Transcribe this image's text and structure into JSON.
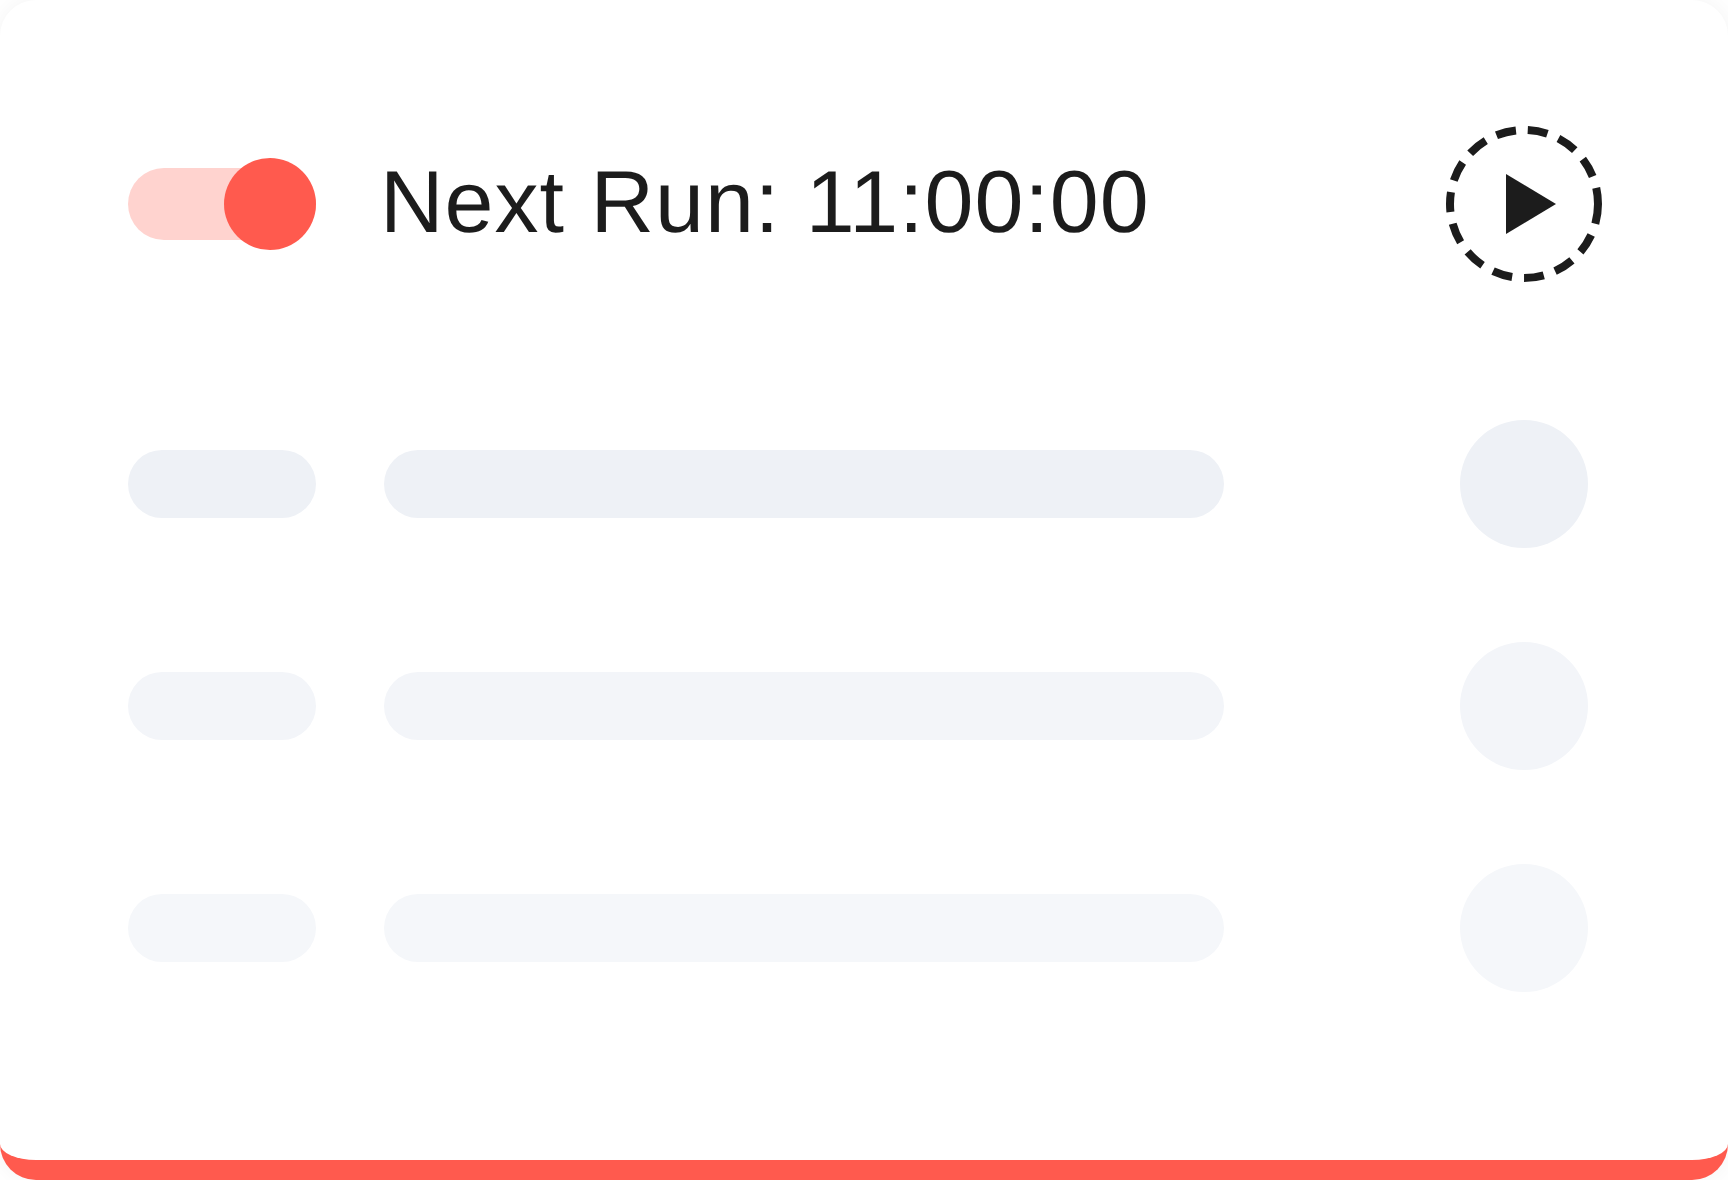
{
  "schedule": {
    "toggle": {
      "on": true
    },
    "next_run": "Next Run: 11:00:00"
  }
}
